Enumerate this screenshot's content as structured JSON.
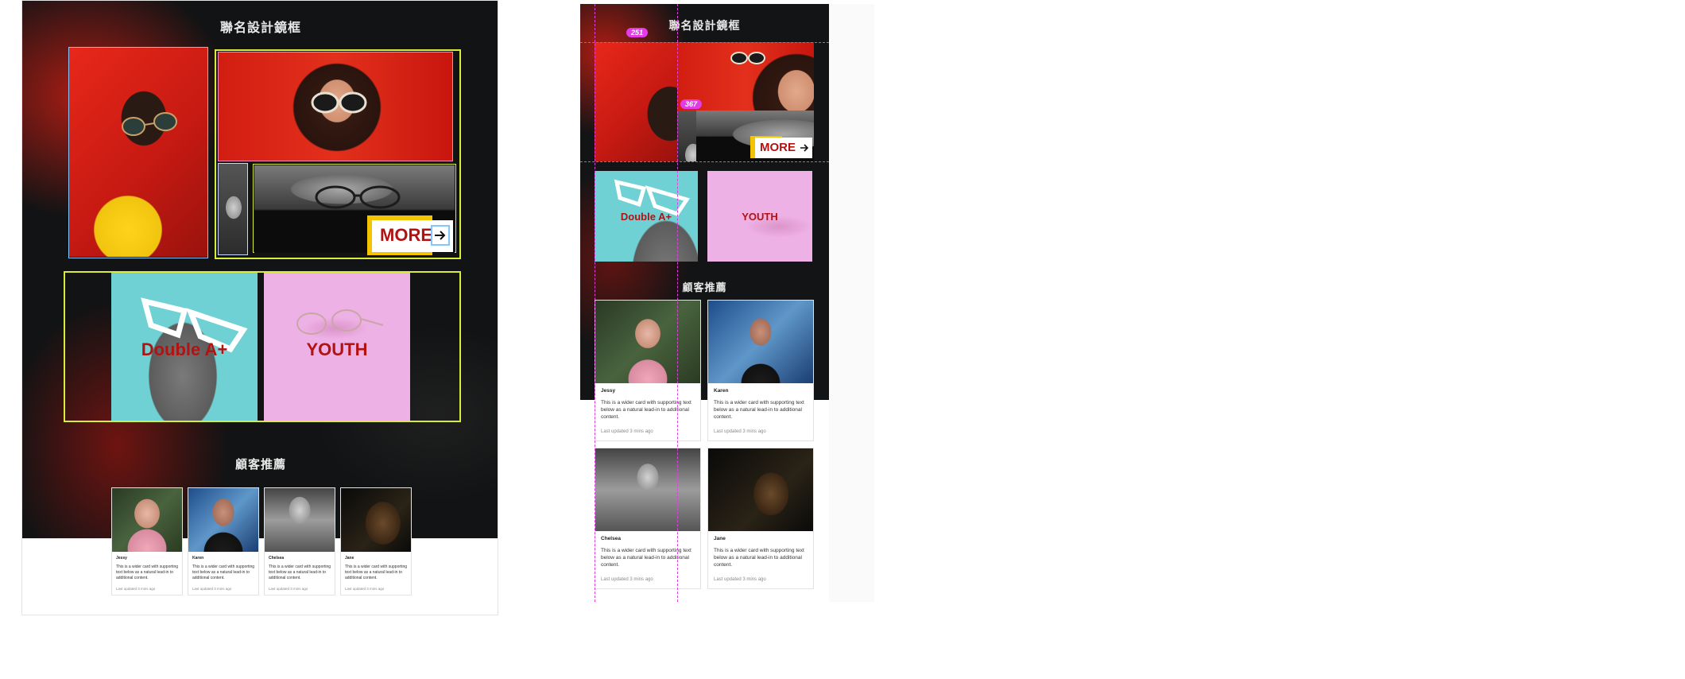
{
  "desktop": {
    "title": "聯名設計鏡框",
    "more_label": "MORE",
    "tile_doublea": "Double A+",
    "tile_youth": "YOUTH",
    "section_title": "顧客推薦",
    "cards": [
      {
        "name": "Jessy",
        "body": "This is a wider card with supporting text below as a natural lead-in to additional content.",
        "meta": "Last updated 3 mins ago"
      },
      {
        "name": "Karen",
        "body": "This is a wider card with supporting text below as a natural lead-in to additional content.",
        "meta": "Last updated 3 mins ago"
      },
      {
        "name": "Chelsea",
        "body": "This is a wider card with supporting text below as a natural lead-in to additional content.",
        "meta": "Last updated 3 mins ago"
      },
      {
        "name": "Jane",
        "body": "This is a wider card with supporting text below as a natural lead-in to additional content.",
        "meta": "Last updated 3 mins ago"
      }
    ]
  },
  "mobile": {
    "title": "聯名設計鏡框",
    "badge_top": "251",
    "badge_mid": "367",
    "more_label": "MORE",
    "tile_doublea": "Double A+",
    "tile_youth": "YOUTH",
    "section_title": "顧客推薦",
    "cards": [
      {
        "name": "Jessy",
        "body": "This is a wider card with supporting text below as a natural lead-in to additional content.",
        "meta": "Last updated 3 mins ago"
      },
      {
        "name": "Karen",
        "body": "This is a wider card with supporting text below as a natural lead-in to additional content.",
        "meta": "Last updated 3 mins ago"
      },
      {
        "name": "Chelsea",
        "body": "This is a wider card with supporting text below as a natural lead-in to additional content.",
        "meta": "Last updated 3 mins ago"
      },
      {
        "name": "Jane",
        "body": "This is a wider card with supporting text below as a natural lead-in to additional content.",
        "meta": "Last updated 3 mins ago"
      }
    ]
  },
  "colors": {
    "brand_red": "#b01312",
    "accent_yellow": "#f4c400",
    "guide_lime": "#d9ec3a",
    "guide_magenta": "#e33ce0",
    "dark_bg": "#121314"
  },
  "icons": [
    "arrow-right-icon",
    "sunglasses-icon"
  ]
}
